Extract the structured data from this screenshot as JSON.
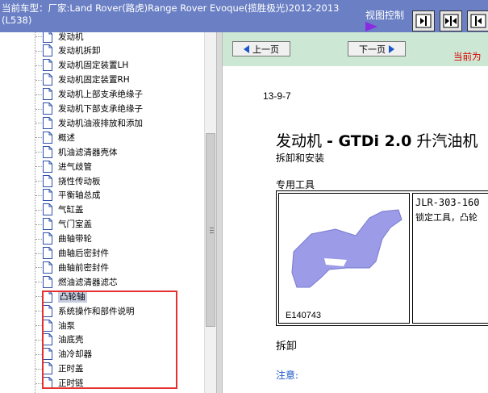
{
  "header": {
    "title": "当前车型：厂家:Land Rover(路虎)Range Rover Evoque(揽胜极光)2012-2013 (L538)",
    "view_control_label": "视图控制",
    "icons": [
      "play-icon",
      "show-right-pane-icon",
      "split-panes-icon",
      "show-left-pane-icon"
    ]
  },
  "tree": {
    "items": [
      {
        "label": "发动机"
      },
      {
        "label": "发动机拆卸"
      },
      {
        "label": "发动机固定装置LH"
      },
      {
        "label": "发动机固定装置RH"
      },
      {
        "label": "发动机上部支承绝缘子"
      },
      {
        "label": "发动机下部支承绝缘子"
      },
      {
        "label": "发动机油液排放和添加"
      },
      {
        "label": "概述"
      },
      {
        "label": "机油滤清器壳体"
      },
      {
        "label": "进气歧管"
      },
      {
        "label": "挠性传动板"
      },
      {
        "label": "平衡轴总成"
      },
      {
        "label": "气缸盖"
      },
      {
        "label": "气门室盖"
      },
      {
        "label": "曲轴带轮"
      },
      {
        "label": "曲轴后密封件"
      },
      {
        "label": "曲轴前密封件"
      },
      {
        "label": "燃油滤清器滤芯"
      },
      {
        "label": "凸轮轴"
      },
      {
        "label": "系统操作和部件说明"
      },
      {
        "label": "油泵"
      },
      {
        "label": "油底壳"
      },
      {
        "label": "油冷却器"
      },
      {
        "label": "正时盖"
      },
      {
        "label": "正时链"
      }
    ],
    "selected_index": 18
  },
  "nav": {
    "prev_label": "上一页",
    "next_label": "下一页",
    "current_label": "当前为"
  },
  "content": {
    "page_code": "13-9-7",
    "title_prefix": "发动机 ",
    "title_bold": "- GTDi 2.0",
    "title_suffix": " 升汽油机",
    "subtitle": "拆卸和安装",
    "tools_heading": "专用工具",
    "tool": {
      "image_ref": "E140743",
      "code": "JLR-303-160",
      "description": "锁定工具，凸轮"
    },
    "removal_heading": "拆卸",
    "note_label": "注意:"
  },
  "colors": {
    "header_bg": "#6a7fc4",
    "nav_bg": "#cce8d4",
    "highlight_red": "#e53030",
    "tool_shape": "#9b9be8"
  }
}
